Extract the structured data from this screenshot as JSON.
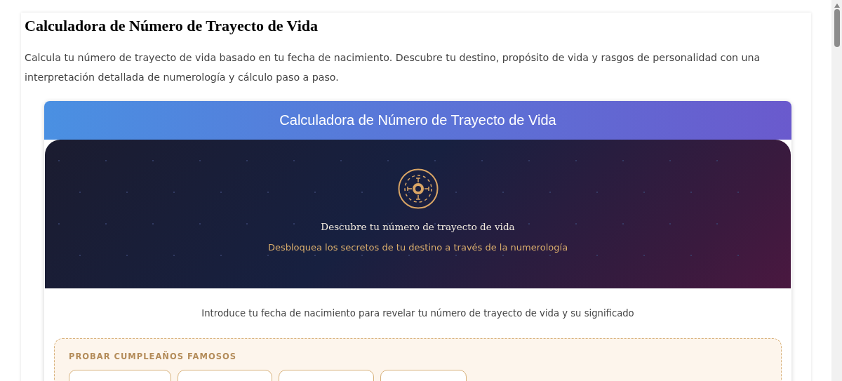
{
  "page": {
    "title": "Calculadora de Número de Trayecto de Vida",
    "intro": "Calcula tu número de trayecto de vida basado en tu fecha de nacimiento. Descubre tu destino, propósito de vida y rasgos de personalidad con una interpretación detallada de numerología y cálculo paso a paso."
  },
  "calculator": {
    "header": "Calculadora de Número de Trayecto de Vida",
    "hero": {
      "heading": "Descubre tu número de trayecto de vida",
      "subheading": "Desbloquea los secretos de tu destino a través de la numerología"
    },
    "prompt": "Introduce tu fecha de nacimiento para revelar tu número de trayecto de vida y su significado",
    "famous": {
      "label": "PROBAR CUMPLEAÑOS FAMOSOS",
      "chips": [
        {
          "kind": "chip"
        },
        {
          "kind": "chip"
        },
        {
          "kind": "chip"
        },
        {
          "kind": "chip"
        }
      ]
    }
  }
}
